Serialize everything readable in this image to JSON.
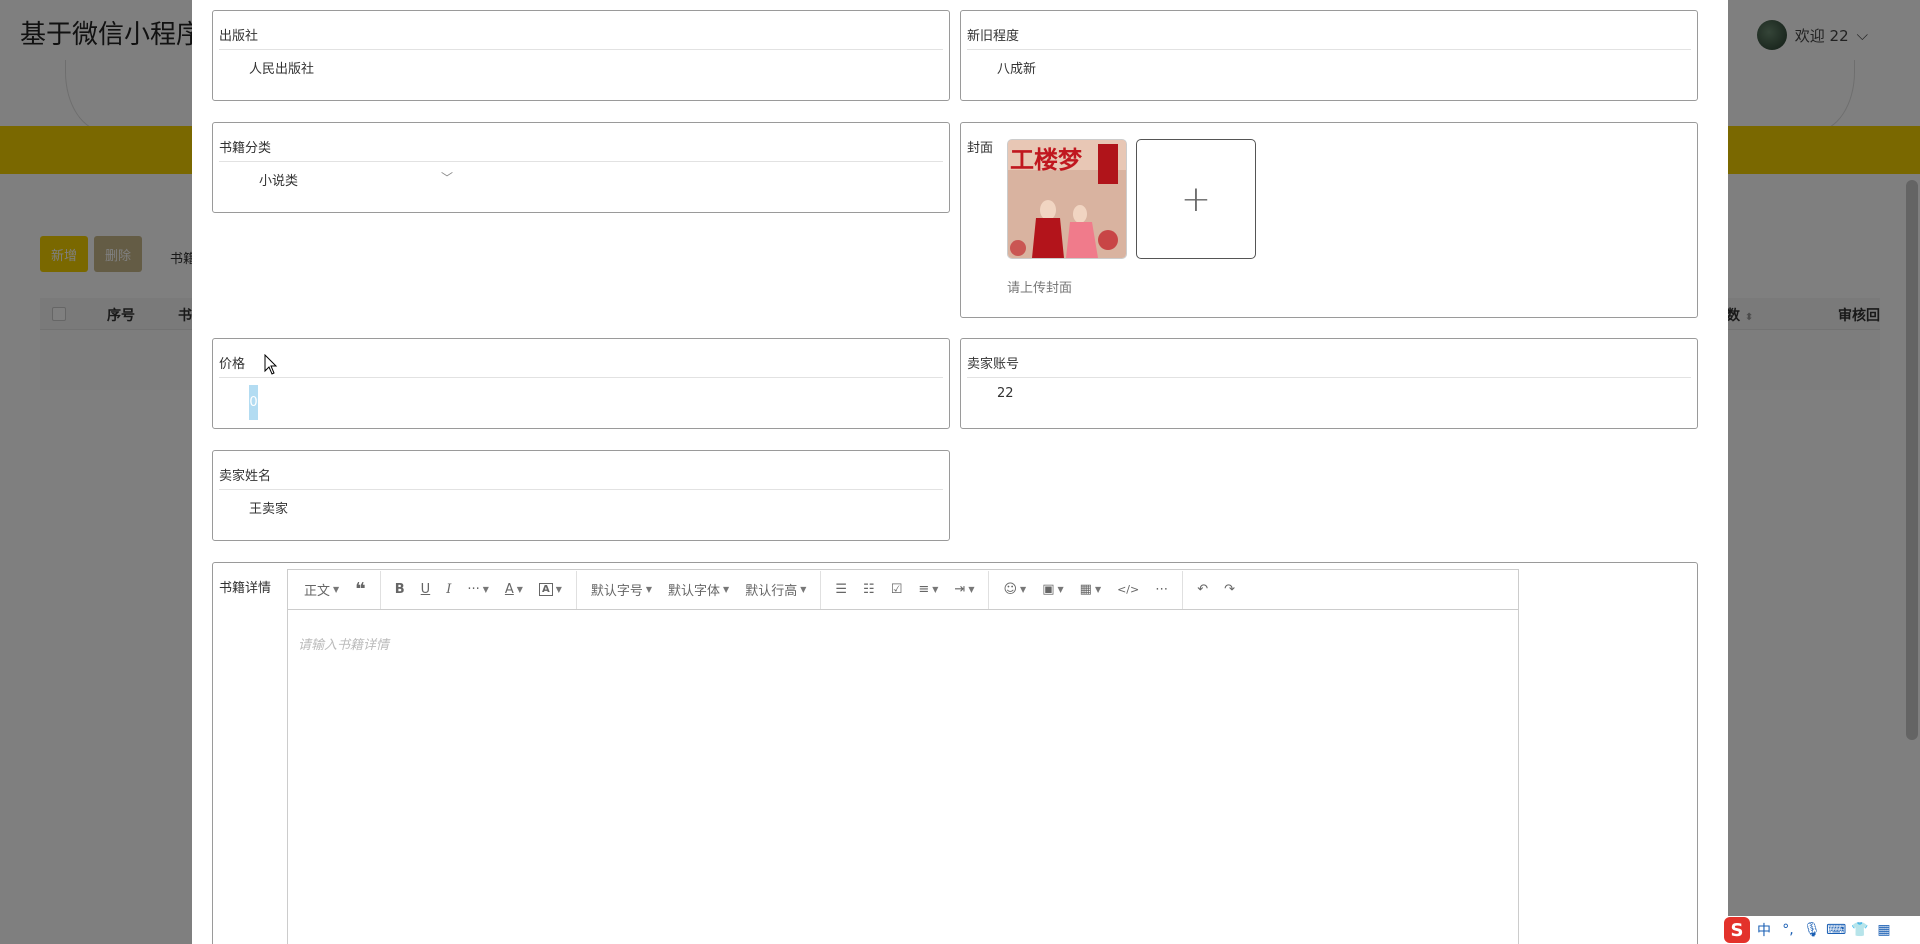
{
  "background": {
    "app_title": "基于微信小程序",
    "welcome": "欢迎 22",
    "add_button": "新增",
    "delete_button": "删除",
    "search_label": "书籍",
    "table_headers": [
      "序号",
      "书",
      "数",
      "审核回"
    ]
  },
  "form": {
    "publisher": {
      "label": "出版社",
      "value": "人民出版社"
    },
    "condition": {
      "label": "新旧程度",
      "value": "八成新"
    },
    "category": {
      "label": "书籍分类",
      "value": "小说类"
    },
    "cover": {
      "label": "封面",
      "upload_tip": "请上传封面"
    },
    "price": {
      "label": "价格",
      "value": "0"
    },
    "seller_account": {
      "label": "卖家账号",
      "value": "22"
    },
    "seller_name": {
      "label": "卖家姓名",
      "value": "王卖家"
    },
    "details": {
      "label": "书籍详情",
      "placeholder": "请输入书籍详情"
    }
  },
  "editor_toolbar": {
    "paragraph": "正文",
    "font_size": "默认字号",
    "font_family": "默认字体",
    "line_height": "默认行高",
    "more": "···"
  },
  "tray": {
    "ime": "S",
    "lang": "中"
  }
}
